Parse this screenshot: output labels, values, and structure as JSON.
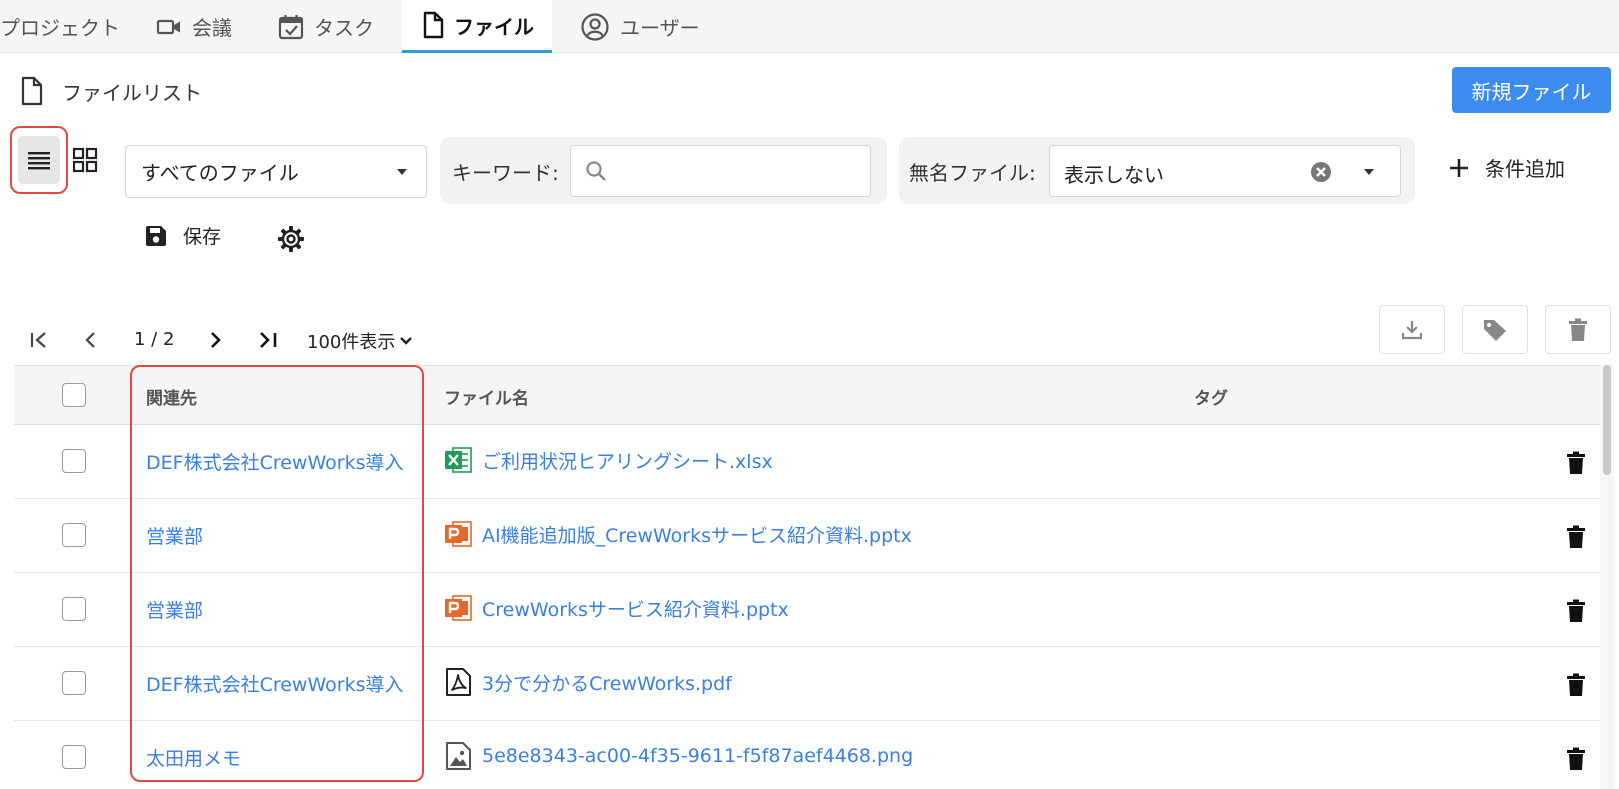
{
  "nav": {
    "tabs": [
      {
        "label": "プロジェクト",
        "icon": "none",
        "active": false
      },
      {
        "label": "会議",
        "icon": "video-icon",
        "active": false
      },
      {
        "label": "タスク",
        "icon": "calendar-check-icon",
        "active": false
      },
      {
        "label": "ファイル",
        "icon": "file-icon",
        "active": true
      },
      {
        "label": "ユーザー",
        "icon": "user-circle-icon",
        "active": false
      }
    ]
  },
  "header": {
    "title": "ファイルリスト",
    "title_icon": "file-icon",
    "new_button": "新規ファイル"
  },
  "filters": {
    "view_mode": "list",
    "file_scope": "すべてのファイル",
    "keyword_label": "キーワード:",
    "keyword_value": "",
    "unnamed_label": "無名ファイル:",
    "unnamed_value": "表示しない",
    "add_condition": "条件追加",
    "save_label": "保存"
  },
  "pager": {
    "page_text": "1 / 2",
    "per_page": "100件表示"
  },
  "table": {
    "columns": [
      "関連先",
      "ファイル名",
      "タグ"
    ],
    "rows": [
      {
        "related": "DEF株式会社CrewWorks導入",
        "file": "ご利用状況ヒアリングシート.xlsx",
        "file_type": "excel-file-icon",
        "tags": ""
      },
      {
        "related": "営業部",
        "file": "AI機能追加版_CrewWorksサービス紹介資料.pptx",
        "file_type": "powerpoint-file-icon",
        "tags": ""
      },
      {
        "related": "営業部",
        "file": "CrewWorksサービス紹介資料.pptx",
        "file_type": "powerpoint-file-icon",
        "tags": ""
      },
      {
        "related": "DEF株式会社CrewWorks導入",
        "file": "3分で分かるCrewWorks.pdf",
        "file_type": "pdf-file-icon",
        "tags": ""
      },
      {
        "related": "太田用メモ",
        "file": "5e8e8343-ac00-4f35-9611-f5f87aef4468.png",
        "file_type": "image-file-icon",
        "tags": ""
      }
    ]
  },
  "colors": {
    "accent": "#3c8cf0",
    "link": "#3a7fe0",
    "tab_underline": "#2e9fd0",
    "highlight": "#e04b40",
    "excel": "#1f9d55",
    "powerpoint": "#e8672a"
  }
}
